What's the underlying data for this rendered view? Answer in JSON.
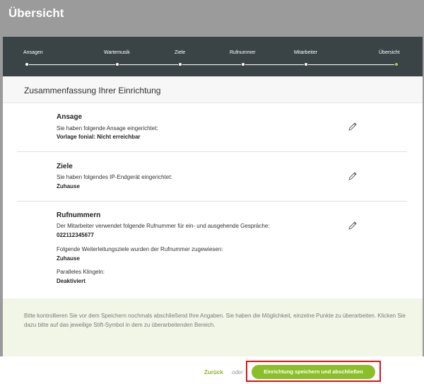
{
  "page": {
    "title": "Übersicht"
  },
  "stepper": {
    "steps": [
      {
        "label": "Ansagen"
      },
      {
        "label": "Wartemusik"
      },
      {
        "label": "Ziele"
      },
      {
        "label": "Rufnummer"
      },
      {
        "label": "Mitarbeiter"
      },
      {
        "label": "Übersicht"
      }
    ],
    "active_step": 6
  },
  "summary": {
    "title": "Zusammenfassung Ihrer Einrichtung",
    "sections": [
      {
        "title": "Ansage",
        "text": "Sie haben folgende Ansage eingerichtet:",
        "value": "Vorlage fonial: Nicht erreichbar"
      },
      {
        "title": "Ziele",
        "text": "Sie haben folgendes IP-Endgerät eingerichtet:",
        "value": "Zuhause"
      },
      {
        "title": "Rufnummern",
        "text": "Der Mitarbeiter verwendet folgende Rufnummer für ein- und ausgehende Gespräche:",
        "value": "022112345677",
        "forward_label": "Folgende Weiterleitungsziele wurden der Rufnummer zugewiesen:",
        "forward_value": "Zuhause",
        "parallel_label": "Paralleles Klingeln:",
        "parallel_value": "Deaktiviert"
      }
    ]
  },
  "info": {
    "text": "Bitte kontrollieren Sie vor dem Speichern nochmals abschließend Ihre Angaben. Sie haben die Möglichkeit, einzelne Punkte zu überarbeiten. Klicken Sie dazu bitte auf das jeweilige Stift-Symbol in dem zu überarbeitenden Bereich."
  },
  "footer": {
    "back_label": "Zurück",
    "or_label": "oder",
    "save_label": "Einrichtung speichern und abschließen"
  },
  "colors": {
    "stepper_bg": "#3a4447",
    "accent_green": "#8bbf2a",
    "highlight_red": "#e0101a",
    "info_bg": "#f2f6e6"
  },
  "icons": {
    "edit": "pencil-icon"
  }
}
